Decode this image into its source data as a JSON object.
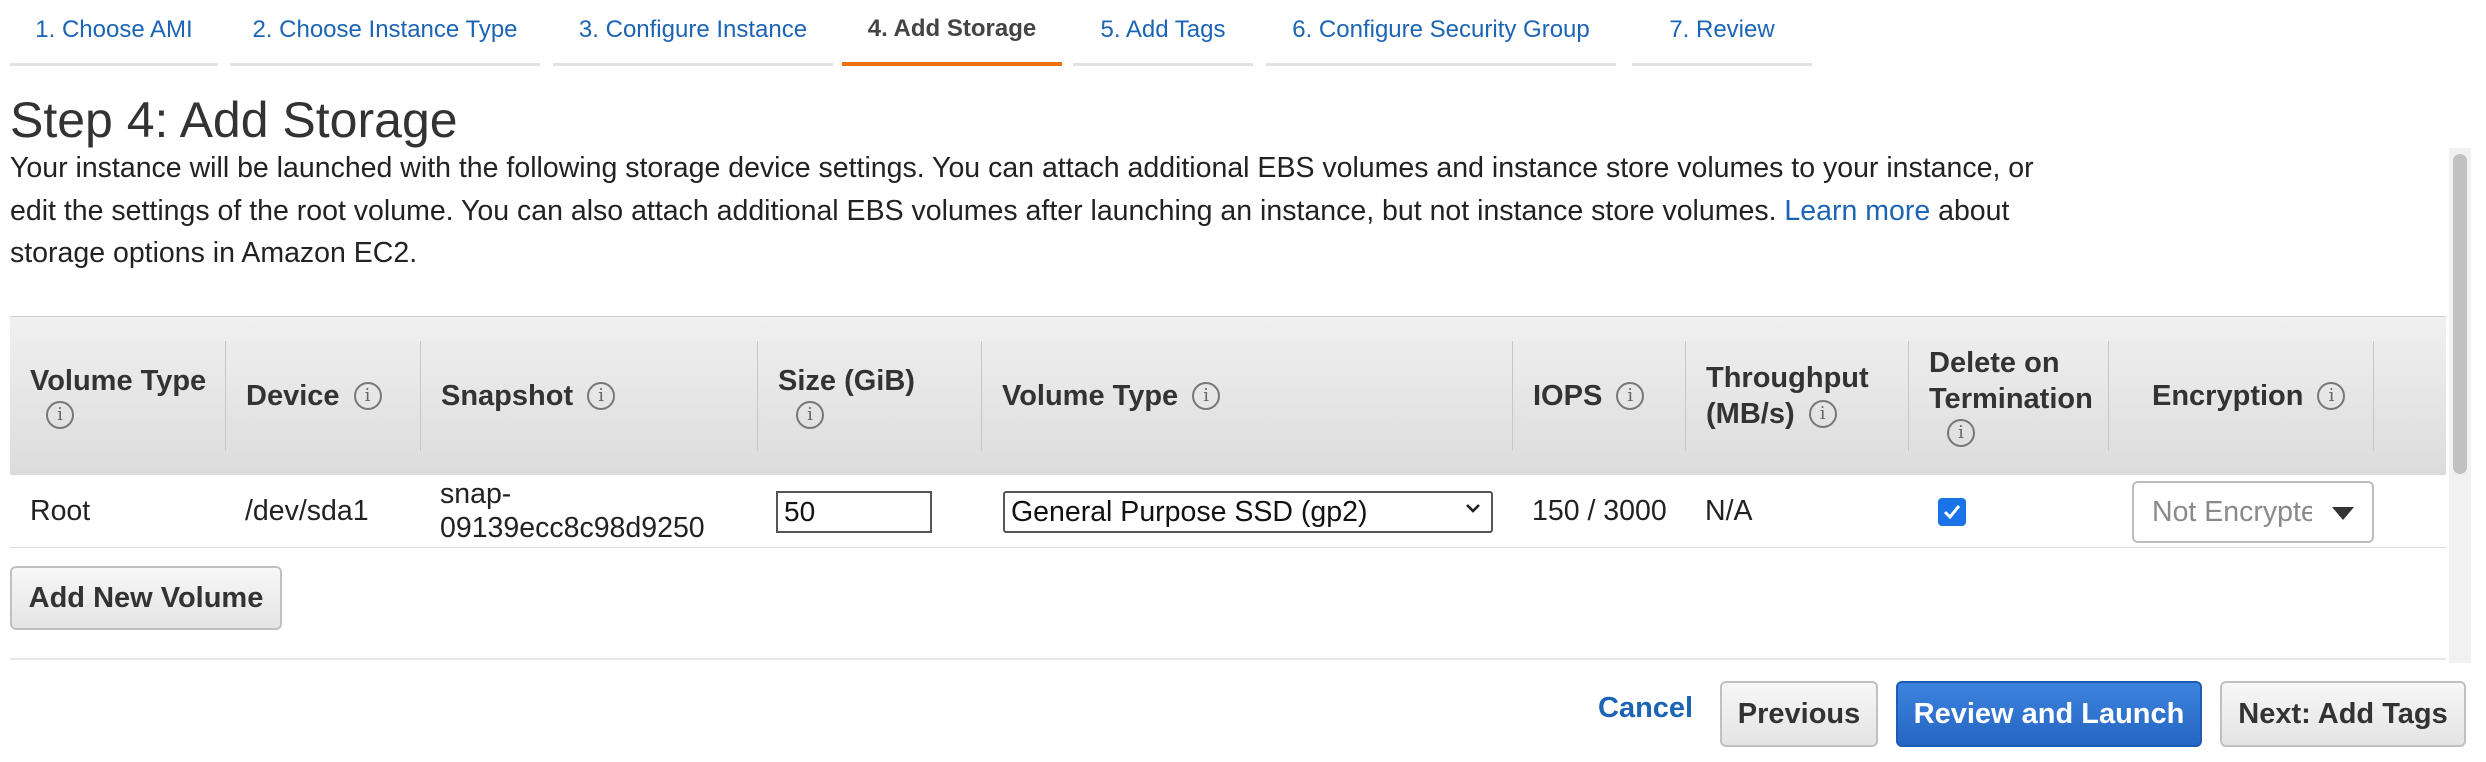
{
  "tabs": [
    {
      "label": "1. Choose AMI"
    },
    {
      "label": "2. Choose Instance Type"
    },
    {
      "label": "3. Configure Instance"
    },
    {
      "label": "4. Add Storage"
    },
    {
      "label": "5. Add Tags"
    },
    {
      "label": "6. Configure Security Group"
    },
    {
      "label": "7. Review"
    }
  ],
  "active_tab": "4. Add Storage",
  "page": {
    "title": "Step 4: Add Storage",
    "description_before_link": "Your instance will be launched with the following storage device settings. You can attach additional EBS volumes and instance store volumes to your instance, or edit the settings of the root volume. You can also attach additional EBS volumes after launching an instance, but not instance store volumes.",
    "link_text": "Learn more",
    "description_after_link": "about storage options in Amazon EC2."
  },
  "table": {
    "headers": {
      "volume_type_l1": "Volume Type",
      "device": "Device",
      "snapshot": "Snapshot",
      "size": "Size (GiB)",
      "volume_type_l2": "Volume Type",
      "iops": "IOPS",
      "throughput_1": "Throughput",
      "throughput_2": "(MB/s)",
      "delete_1": "Delete on",
      "delete_2": "Termination",
      "encryption": "Encryption"
    },
    "rows": [
      {
        "volume_type": "Root",
        "device": "/dev/sda1",
        "snapshot_1": "snap-",
        "snapshot_2": "09139ecc8c98d9250",
        "size": "50",
        "volume_type_select": "General Purpose SSD (gp2)",
        "iops": "150 / 3000",
        "throughput": "N/A",
        "delete_on_termination": true,
        "encryption": "Not Encrypted"
      }
    ]
  },
  "buttons": {
    "add_volume": "Add New Volume",
    "cancel": "Cancel",
    "previous": "Previous",
    "review_launch": "Review and Launch",
    "next": "Next: Add Tags"
  },
  "icons": {
    "info": "info-icon",
    "chevron": "chevron-down-icon",
    "check": "check-icon",
    "caret": "caret-down-icon"
  },
  "colors": {
    "link": "#1c64b4",
    "active_tab_underline": "#ec7211",
    "primary_button": "#2466c2",
    "checkbox": "#1a73e8"
  }
}
